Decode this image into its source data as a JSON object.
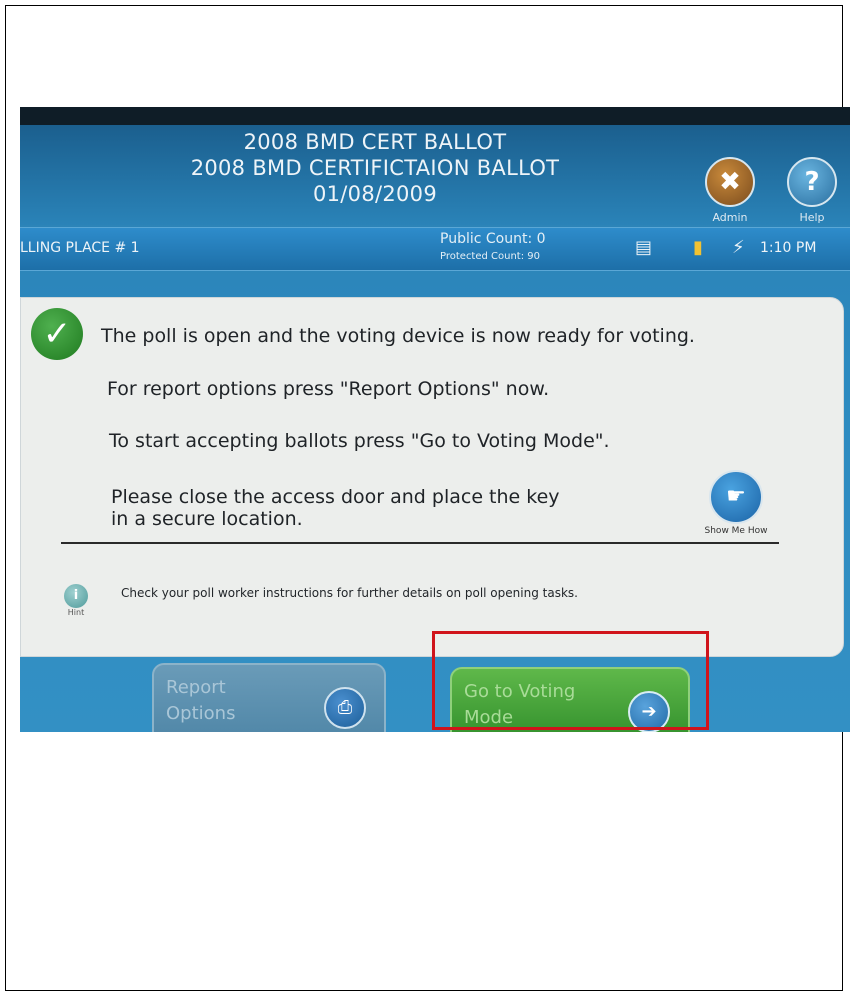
{
  "header": {
    "title_line1": "2008 BMD CERT BALLOT",
    "title_line2": "2008 BMD CERTIFICTAION BALLOT",
    "date": "01/08/2009",
    "admin_label": "Admin",
    "help_label": "Help"
  },
  "status_bar": {
    "polling_place": "LLING PLACE # 1",
    "public_count": "Public Count: 0",
    "protected_count": "Protected Count: 90",
    "time": "1:10 PM"
  },
  "message": {
    "line1": "The poll is open and the voting device is now ready for voting.",
    "line2": "For report options press \"Report Options\" now.",
    "line3": "To start accepting ballots press \"Go to Voting Mode\".",
    "line4a": "Please close the access door and place the key",
    "line4b": "in a secure location.",
    "show_me_how": "Show Me How",
    "hint_label": "Hint",
    "hint_text": "Check your poll worker instructions for further details on poll opening tasks."
  },
  "buttons": {
    "report_line1": "Report",
    "report_line2": "Options",
    "voting_line1": "Go to Voting",
    "voting_line2": "Mode"
  },
  "icons": {
    "admin": "tools-icon",
    "help": "question-icon",
    "check": "checkmark-icon",
    "show_me": "hand-icon",
    "hint": "info-icon",
    "report": "printer-icon",
    "voting": "arrow-right-icon"
  },
  "colors": {
    "highlight": "#d0141b",
    "voting_button": "#3f9d35",
    "report_button": "#5a8fae"
  }
}
